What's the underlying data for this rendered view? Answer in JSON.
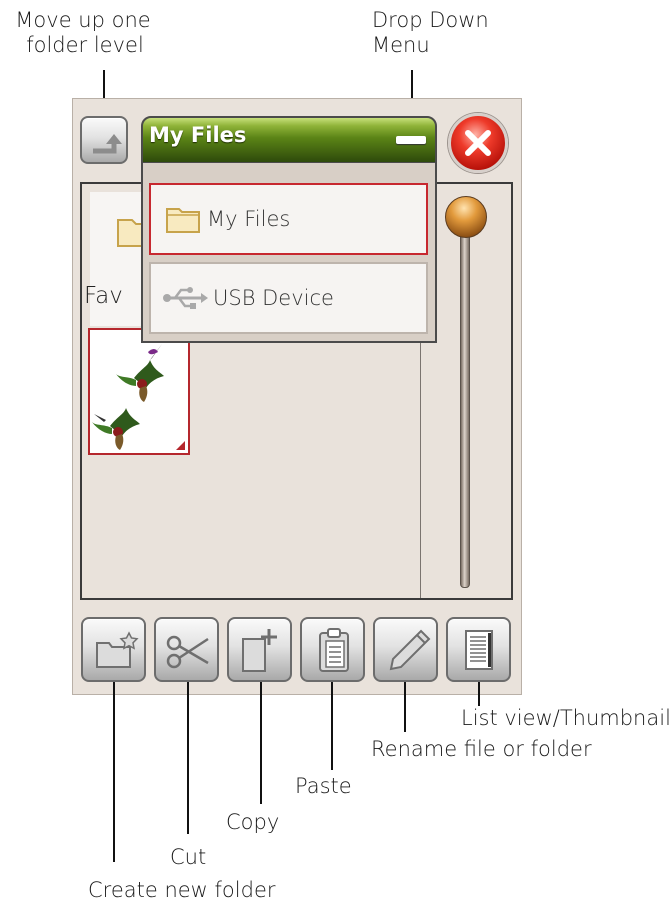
{
  "callouts": {
    "move_up": [
      "Move up one",
      "folder level"
    ],
    "drop_down": [
      "Drop Down",
      "Menu"
    ],
    "list_view": "List view/Thumbnail",
    "rename": "Rename file or folder",
    "paste": "Paste",
    "copy": "Copy",
    "cut": "Cut",
    "create_folder": "Create new folder"
  },
  "dropdown": {
    "title": "My Files",
    "items": [
      {
        "label": "My Files",
        "icon": "folder-icon",
        "selected": true
      },
      {
        "label": "USB Device",
        "icon": "usb-icon",
        "selected": false
      }
    ]
  },
  "file_area": {
    "favorites_label": "Fav"
  },
  "toolbar": [
    {
      "name": "create-folder",
      "icon": "folder-star-icon"
    },
    {
      "name": "cut",
      "icon": "scissors-icon"
    },
    {
      "name": "copy",
      "icon": "copy-icon"
    },
    {
      "name": "paste",
      "icon": "clipboard-icon"
    },
    {
      "name": "rename",
      "icon": "pencil-icon"
    },
    {
      "name": "list-view",
      "icon": "list-icon"
    }
  ],
  "colors": {
    "panel_bg": "#e9e2db",
    "header_green": "#5b8416",
    "selection_red": "#c7282f",
    "close_red": "#ee3a2a",
    "knob_orange": "#e29a3c"
  }
}
